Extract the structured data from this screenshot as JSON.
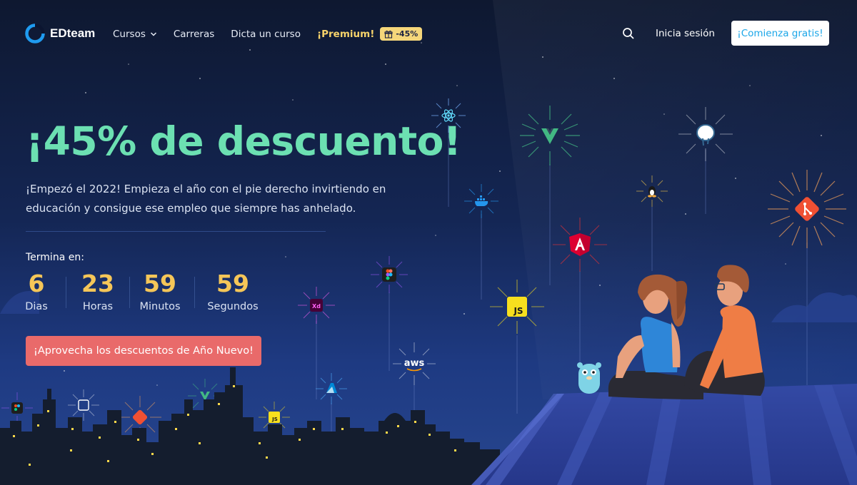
{
  "header": {
    "logo_text": "EDteam",
    "nav": [
      {
        "label": "Cursos"
      },
      {
        "label": "Carreras"
      },
      {
        "label": "Dicta un curso"
      },
      {
        "label": "¡Premium!"
      }
    ],
    "premium_badge": "-45%",
    "login_label": "Inicia sesión",
    "cta_label": "¡Comienza gratis!"
  },
  "hero": {
    "title": "¡45% de descuento!",
    "description": "¡Empezó el 2022! Empieza el año con el pie derecho invirtiendo en educación y consigue ese empleo que siempre has anhelado.",
    "ends_label": "Termina en:",
    "countdown": [
      {
        "value": "6",
        "label": "Dias"
      },
      {
        "value": "23",
        "label": "Horas"
      },
      {
        "value": "59",
        "label": "Minutos"
      },
      {
        "value": "59",
        "label": "Segundos"
      }
    ],
    "cta_label": "¡Aprovecha los descuentos de Año Nuevo!"
  },
  "fireworks": {
    "labels": {
      "aws": "aws",
      "js": "JS",
      "js_small": "JS",
      "xd": "Xd"
    },
    "icons": [
      "react-icon",
      "vue-icon",
      "postgresql-icon",
      "docker-icon",
      "linux-icon",
      "git-icon",
      "angular-icon",
      "figma-icon",
      "adobe-xd-icon",
      "javascript-icon",
      "aws-icon",
      "azure-icon",
      "css3-icon"
    ]
  },
  "colors": {
    "accent_green": "#6ce0b2",
    "countdown_yellow": "#f5c658",
    "cta_red": "#e96a6a",
    "cta_top_text": "#1aa6e8",
    "premium_yellow": "#f7d36b"
  }
}
